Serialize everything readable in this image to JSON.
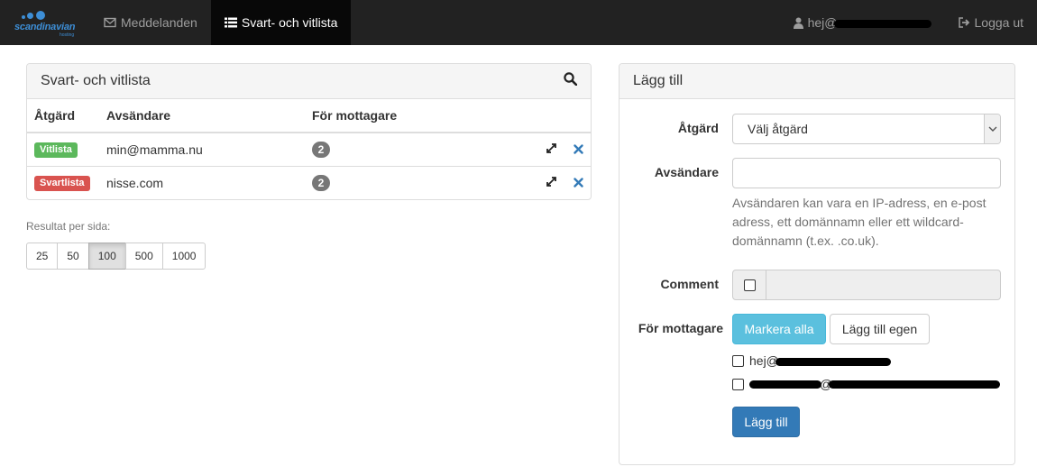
{
  "brand": {
    "name": "scandinavian",
    "sub": "hosting"
  },
  "nav": {
    "messages": "Meddelanden",
    "blackwhite": "Svart- och vitlista",
    "user": "hej@",
    "logout": "Logga ut"
  },
  "list_panel": {
    "title": "Svart- och vitlista",
    "columns": {
      "action": "Åtgärd",
      "sender": "Avsändare",
      "recipients": "För mottagare"
    },
    "rows": [
      {
        "label": "Vitlista",
        "sender": "min@mamma.nu",
        "count": "2"
      },
      {
        "label": "Svartlista",
        "sender": "nisse.com",
        "count": "2"
      }
    ]
  },
  "pagination": {
    "label": "Resultat per sida:",
    "options": [
      "25",
      "50",
      "100",
      "500",
      "1000"
    ],
    "selected": "100"
  },
  "add_panel": {
    "title": "Lägg till",
    "action_label": "Åtgärd",
    "action_value": "Välj åtgärd",
    "sender_label": "Avsändare",
    "sender_value": "",
    "help": "Avsändaren kan vara en IP-adress, en e-post adress, ett domännamn eller ett wildcard-domännamn (t.ex. .co.uk).",
    "comment_label": "Comment",
    "recipients_label": "För mottagare",
    "select_all": "Markera alla",
    "add_own": "Lägg till egen",
    "recipients": [
      "hej@",
      "@"
    ],
    "submit": "Lägg till"
  },
  "colors": {
    "navbar": "#222222",
    "success": "#5cb85c",
    "danger": "#d9534f",
    "info": "#5bc0de",
    "primary": "#337ab7"
  }
}
